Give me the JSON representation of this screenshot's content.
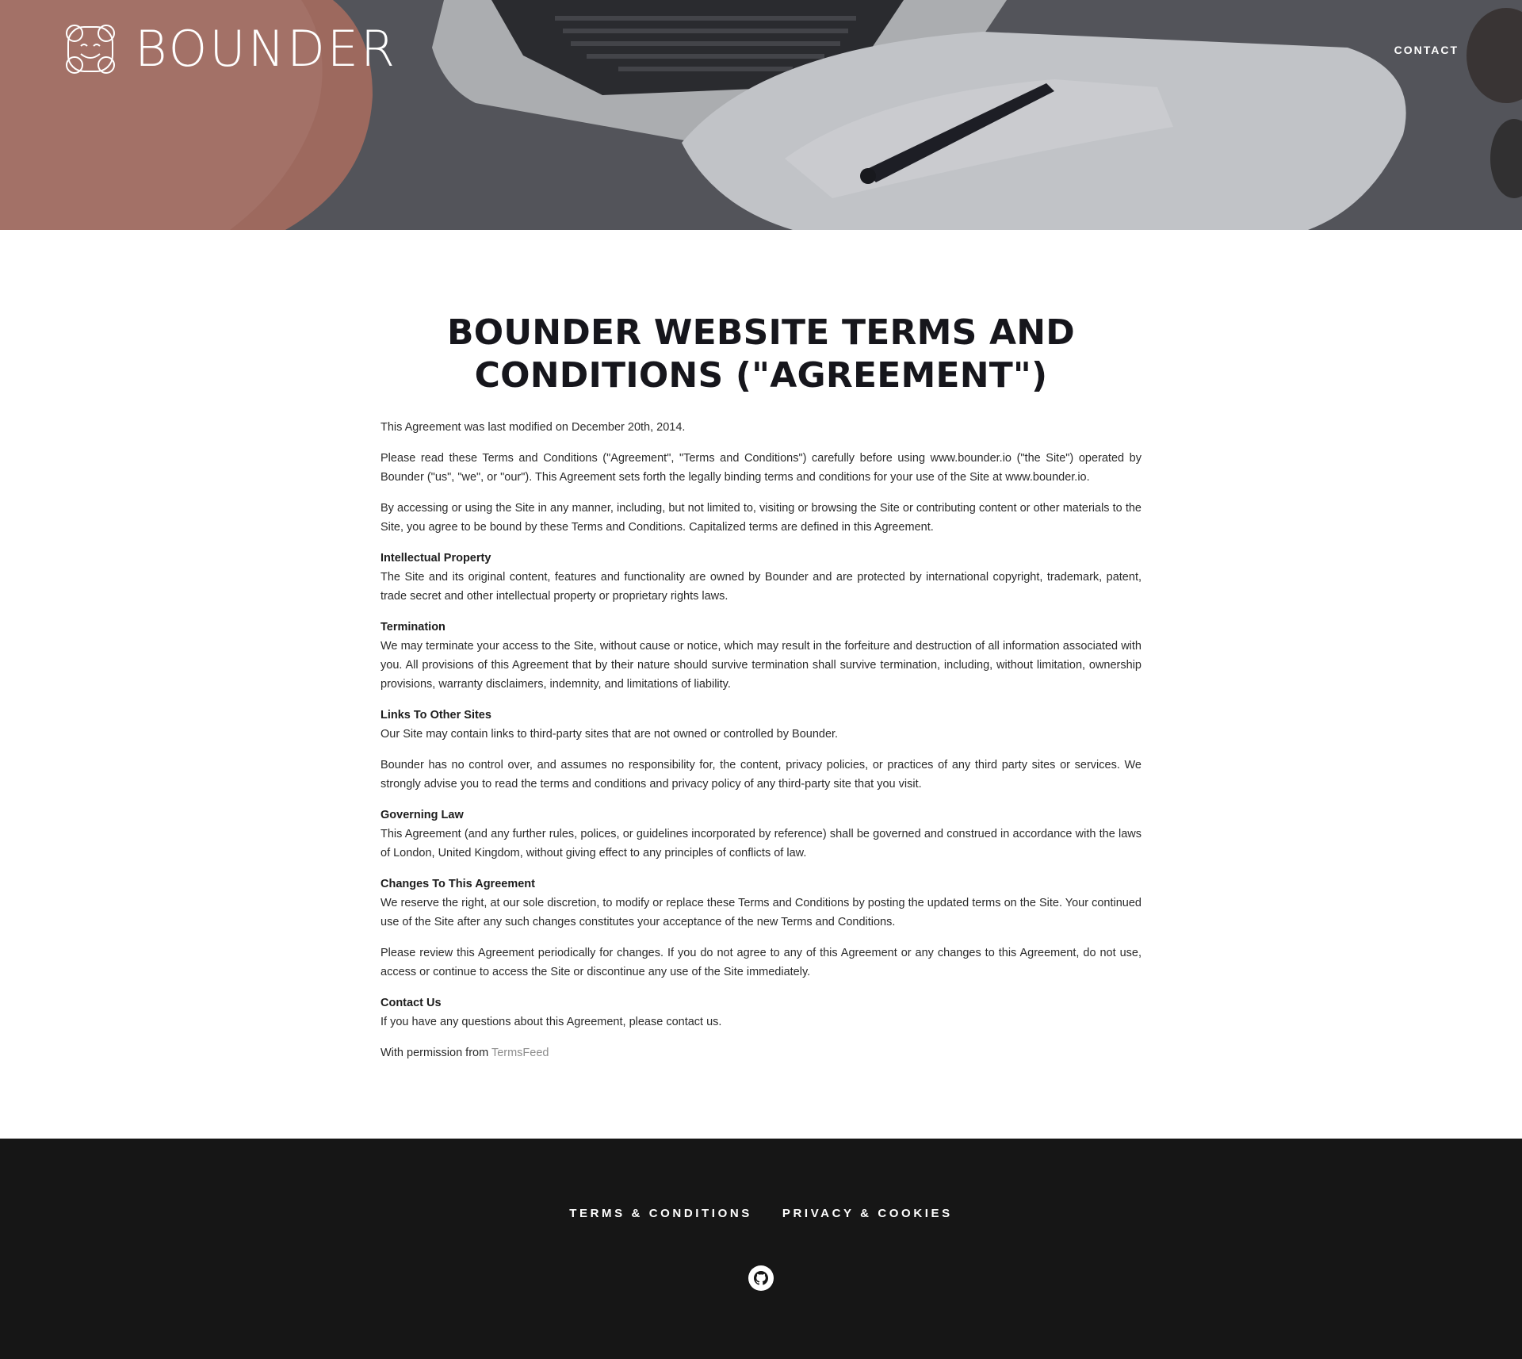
{
  "header": {
    "logo_text": "BOUNDER",
    "nav": {
      "contact_label": "CONTACT"
    }
  },
  "main": {
    "title": "BOUNDER WEBSITE TERMS AND CONDITIONS (\"AGREEMENT\")",
    "modified": "This Agreement was last modified on December 20th, 2014.",
    "intro1": "Please read these Terms and Conditions (\"Agreement\", \"Terms and Conditions\") carefully before using www.bounder.io (\"the Site\") operated by Bounder (\"us\", \"we\", or \"our\"). This Agreement sets forth the legally binding terms and conditions for your use of the Site at www.bounder.io.",
    "intro2": "By accessing or using the Site in any manner, including, but not limited to, visiting or browsing the Site or contributing content or other materials to the Site, you agree to be bound by these Terms and Conditions. Capitalized terms are defined in this Agreement.",
    "sections": [
      {
        "heading": "Intellectual Property",
        "body": "The Site and its original content, features and functionality are owned by Bounder and are protected by international copyright, trademark, patent, trade secret and other intellectual property or proprietary rights laws."
      },
      {
        "heading": "Termination",
        "body": "We may terminate your access to the Site, without cause or notice, which may result in the forfeiture and destruction of all information associated with you. All provisions of this Agreement that by their nature should survive termination shall survive termination, including, without limitation, ownership provisions, warranty disclaimers, indemnity, and limitations of liability."
      },
      {
        "heading": "Links To Other Sites",
        "body": "Our Site may contain links to third-party sites that are not owned or controlled by Bounder.",
        "extra": "Bounder has no control over, and assumes no responsibility for, the content, privacy policies, or practices of any third party sites or services. We strongly advise you to read the terms and conditions and privacy policy of any third-party site that you visit."
      },
      {
        "heading": "Governing Law",
        "body": "This Agreement (and any further rules, polices, or guidelines incorporated by reference) shall be governed and construed in accordance with the laws of London, United Kingdom, without giving effect to any principles of conflicts of law."
      },
      {
        "heading": "Changes To This Agreement",
        "body": "We reserve the right, at our sole discretion, to modify or replace these Terms and Conditions by posting the updated terms on the Site. Your continued use of the Site after any such changes constitutes your acceptance of the new Terms and Conditions.",
        "extra": "Please review this Agreement periodically for changes. If you do not agree to any of this Agreement or any changes to this Agreement, do not use, access or continue to access the Site or discontinue any use of the Site immediately."
      },
      {
        "heading": "Contact Us",
        "body": "If you have any questions about this Agreement, please contact us."
      }
    ],
    "permission_prefix": "With permission from ",
    "permission_link": "TermsFeed"
  },
  "footer": {
    "links": [
      "TERMS & CONDITIONS",
      "PRIVACY & COOKIES"
    ],
    "social_icon": "github-icon"
  }
}
